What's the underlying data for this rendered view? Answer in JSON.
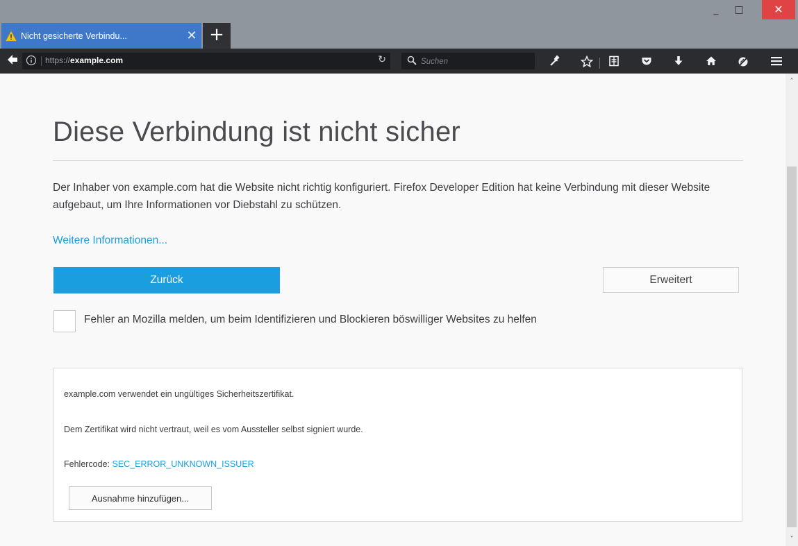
{
  "window": {
    "minimize_glyph": "_",
    "maximize_glyph": "□",
    "close_glyph": "✕",
    "close_color": "#e04343"
  },
  "tab": {
    "title": "Nicht gesicherte Verbindu...",
    "close_glyph": "✕",
    "warning_icon": "warning-triangle-icon",
    "color": "#3f78c8"
  },
  "new_tab": {
    "glyph": "+"
  },
  "toolbar": {
    "back_glyph": "🡐",
    "url_prefix": "https://",
    "url_host": "example.com",
    "reload_glyph": "↻",
    "search_placeholder": "Suchen",
    "icons": [
      "wrench-icon",
      "star-icon",
      "reading-list-icon",
      "pocket-icon",
      "download-icon",
      "home-icon",
      "tracking-icon",
      "menu-icon"
    ]
  },
  "page": {
    "heading": "Diese Verbindung ist nicht sicher",
    "description": "Der Inhaber von example.com hat die Website nicht richtig konfiguriert. Firefox Developer Edition hat keine Verbindung mit dieser Website aufgebaut, um Ihre Informationen vor Diebstahl zu schützen.",
    "learn_more": "Weitere Informationen...",
    "back_button": "Zurück",
    "advanced_button": "Erweitert",
    "report_checkbox_checked": false,
    "report_label": "Fehler an Mozilla melden, um beim Identifizieren und Blockieren böswilliger Websites zu helfen",
    "accent_color": "#1a9ee0"
  },
  "details": {
    "line1": "example.com verwendet ein ungültiges Sicherheitszertifikat.",
    "line2": "Dem Zertifikat wird nicht vertraut, weil es vom Aussteller selbst signiert wurde.",
    "error_label": "Fehlercode: ",
    "error_code": "SEC_ERROR_UNKNOWN_ISSUER",
    "exception_button": "Ausnahme hinzufügen..."
  },
  "scrollbar": {
    "up_glyph": "˄",
    "down_glyph": "˅"
  }
}
